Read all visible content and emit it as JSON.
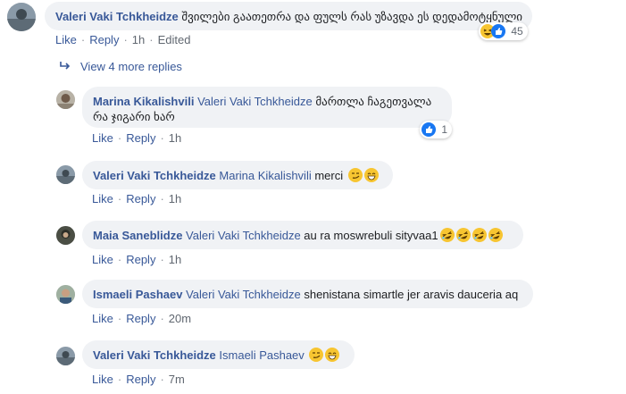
{
  "actions": {
    "like": "Like",
    "reply": "Reply",
    "edited": "Edited",
    "sep": "·"
  },
  "top_comment": {
    "author": "Valeri Vaki Tchkheidze",
    "text": "შვილები გაათეთრა და ფულს რას უზავდა ეს დედამოტყნული",
    "time": "1h",
    "reaction_count": "45"
  },
  "view_more_replies": "View 4 more replies",
  "replies": [
    {
      "author": "Marina Kikalishvili",
      "mention": "Valeri Vaki Tchkheidze",
      "text": "მართლა ჩაგეთვალა რა ჯიგარი ხარ",
      "time": "1h",
      "reaction_count": "1"
    },
    {
      "author": "Valeri Vaki Tchkheidze",
      "mention": "Marina Kikalishvili",
      "text": "merci",
      "time": "1h"
    },
    {
      "author": "Maia Saneblidze",
      "mention": "Valeri Vaki Tchkheidze",
      "text": "au ra moswrebuli sityvaa1",
      "time": "1h"
    },
    {
      "author": "Ismaeli Pashaev",
      "mention": "Valeri Vaki Tchkheidze",
      "text": "shenistana simartle jer aravis dauceria aq",
      "time": "20m"
    },
    {
      "author": "Valeri Vaki Tchkheidze",
      "mention": "Ismaeli Pashaev",
      "text": "",
      "time": "7m"
    }
  ],
  "colors": {
    "link": "#385898",
    "bubble": "#f0f2f5",
    "like_blue": "#1877f2",
    "emoji_yellow": "#f7c531"
  },
  "icons": {
    "smirk": "smirking-face-icon",
    "grin": "grinning-face-icon",
    "laugh": "rolling-laughing-icon",
    "like": "thumbs-up-icon",
    "haha": "haha-icon",
    "reply_arrow": "reply-arrow-icon"
  }
}
